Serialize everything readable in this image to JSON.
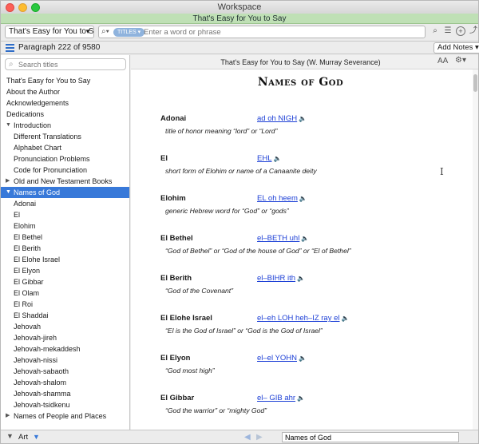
{
  "window": {
    "title": "Workspace"
  },
  "docbar": {
    "title": "That's Easy for You to Say"
  },
  "toolbar": {
    "resource_select": "That's Easy for You to Say",
    "scope_pill": "TITLES",
    "search_placeholder": "Enter a word or phrase"
  },
  "parabar": {
    "position": "Paragraph 222 of 9580",
    "add_notes": "Add Notes"
  },
  "sidebar": {
    "search_placeholder": "Search titles",
    "items": [
      {
        "label": "That's Easy for You to Say",
        "level": 0
      },
      {
        "label": "About the Author",
        "level": 0
      },
      {
        "label": "Acknowledgements",
        "level": 0
      },
      {
        "label": "Dedications",
        "level": 0
      },
      {
        "label": "Introduction",
        "level": 0,
        "expanded": true
      },
      {
        "label": "Different Translations",
        "level": 1
      },
      {
        "label": "Alphabet Chart",
        "level": 1
      },
      {
        "label": "Pronunciation Problems",
        "level": 1
      },
      {
        "label": "Code for Pronunciation",
        "level": 1
      },
      {
        "label": "Old and New Testament Books",
        "level": 0,
        "expanded": false
      },
      {
        "label": "Names of God",
        "level": 0,
        "expanded": true,
        "selected": true
      },
      {
        "label": "Adonai",
        "level": 1
      },
      {
        "label": "El",
        "level": 1
      },
      {
        "label": "Elohim",
        "level": 1
      },
      {
        "label": "El Bethel",
        "level": 1
      },
      {
        "label": "El Berith",
        "level": 1
      },
      {
        "label": "El Elohe Israel",
        "level": 1
      },
      {
        "label": "El Elyon",
        "level": 1
      },
      {
        "label": "El Gibbar",
        "level": 1
      },
      {
        "label": "El Olam",
        "level": 1
      },
      {
        "label": "El Roi",
        "level": 1
      },
      {
        "label": "El Shaddai",
        "level": 1
      },
      {
        "label": "Jehovah",
        "level": 1
      },
      {
        "label": "Jehovah-jireh",
        "level": 1
      },
      {
        "label": "Jehovah-mekaddesh",
        "level": 1
      },
      {
        "label": "Jehovah-nissi",
        "level": 1
      },
      {
        "label": "Jehovah-sabaoth",
        "level": 1
      },
      {
        "label": "Jehovah-shalom",
        "level": 1
      },
      {
        "label": "Jehovah-shamma",
        "level": 1
      },
      {
        "label": "Jehovah-tsidkenu",
        "level": 1
      },
      {
        "label": "Names of People and Places",
        "level": 0,
        "expanded": false
      }
    ]
  },
  "main": {
    "header_title": "That's Easy for You to Say (W. Murray Severance)",
    "font_size_label": "AA",
    "page_title": "Names of God",
    "entries": [
      {
        "term": "Adonai",
        "pron": "ad oh NIGH",
        "def": "title of honor meaning “lord” or “Lord”"
      },
      {
        "term": "El",
        "pron": "EHL",
        "def": "short form of Elohim or name of a Canaanite deity"
      },
      {
        "term": "Elohim",
        "pron": "EL oh heem",
        "def": "generic Hebrew word for “God” or “gods”"
      },
      {
        "term": "El Bethel",
        "pron": "el–BETH uhl",
        "def": "“God of Bethel” or “God of the house of God” or “El of Bethel”"
      },
      {
        "term": "El Berith",
        "pron": "el–BIHR ith",
        "def": "“God of the Covenant”"
      },
      {
        "term": "El Elohe Israel",
        "pron": "el–eh LOH heh–IZ ray el",
        "def": "“El is the God of Israel” or “God is the God of Israel”"
      },
      {
        "term": "El Elyon",
        "pron": "el–el YOHN",
        "def": "“God most high”"
      },
      {
        "term": "El Gibbar",
        "pron": "el– GIB ahr",
        "def": "“God the warrior” or “mighty God”"
      }
    ]
  },
  "bottombar": {
    "art_label": "Art",
    "location": "Names of God"
  },
  "colors": {
    "accent": "#3879d9",
    "doc_bar": "#bfe0b5",
    "link": "#1c3fd6"
  }
}
